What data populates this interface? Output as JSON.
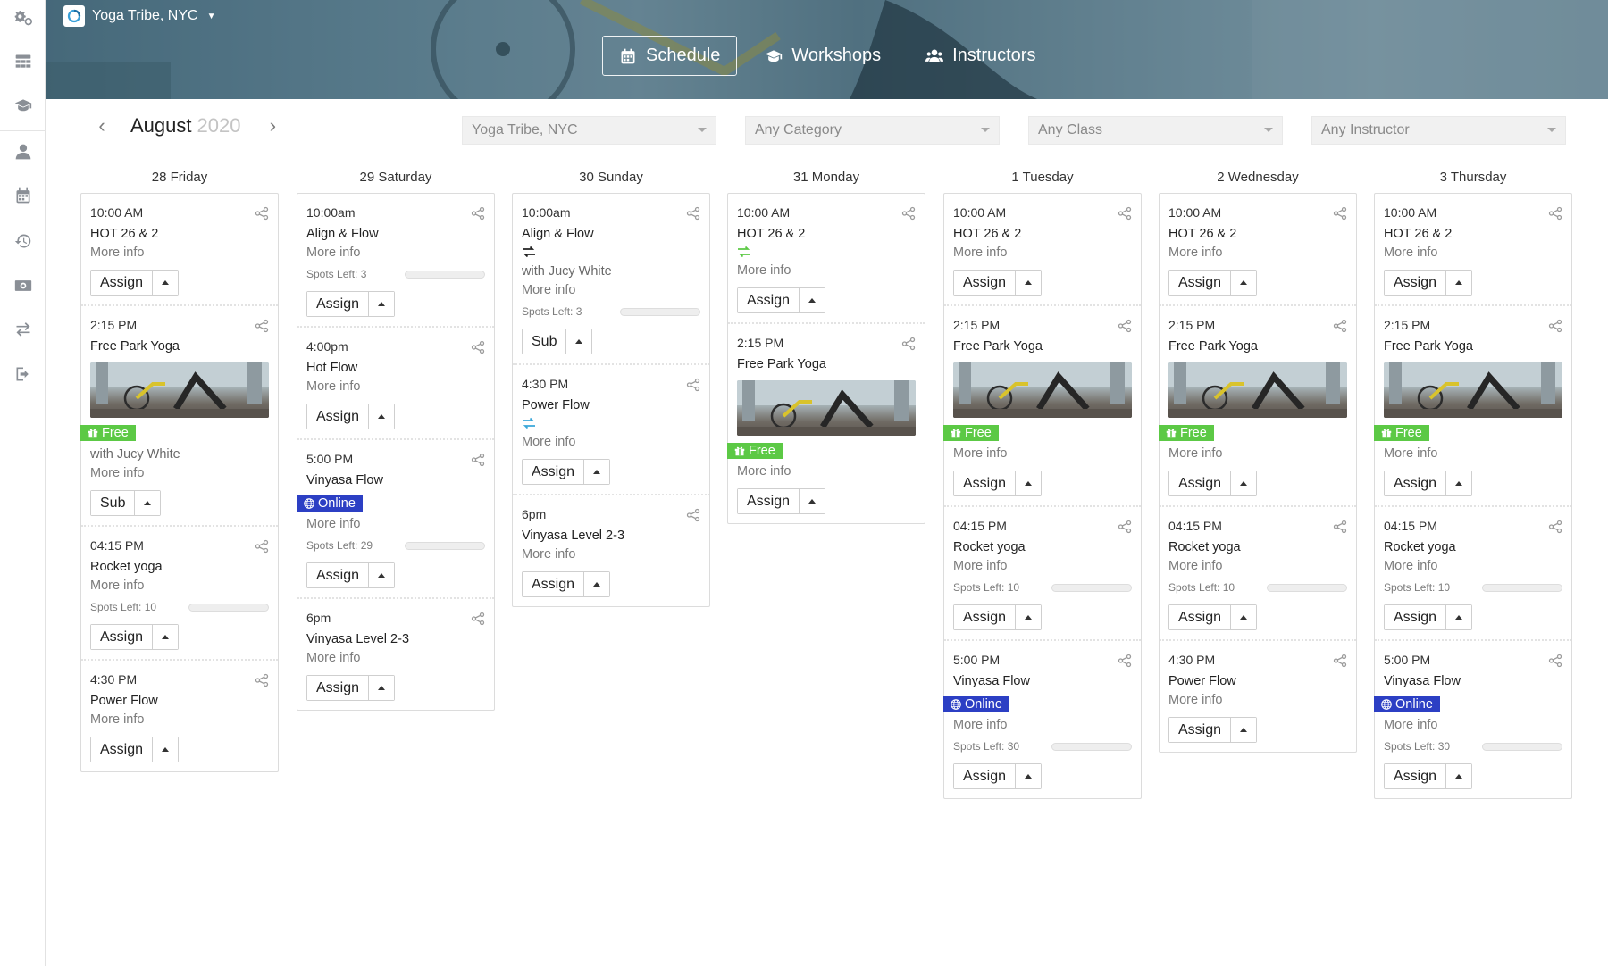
{
  "studio": {
    "name": "Yoga Tribe, NYC"
  },
  "nav": [
    {
      "label": "Schedule",
      "icon": "calendar-icon",
      "active": true
    },
    {
      "label": "Workshops",
      "icon": "graduation-cap-icon",
      "active": false
    },
    {
      "label": "Instructors",
      "icon": "users-icon",
      "active": false
    }
  ],
  "sidebar": [
    "gears-icon",
    "dashboard-icon",
    "graduation-cap-icon",
    "user-icon",
    "calendar-icon",
    "history-icon",
    "money-icon",
    "exchange-icon",
    "sign-out-icon"
  ],
  "calendar": {
    "month": "August",
    "year": "2020"
  },
  "filters": {
    "studio": "Yoga Tribe, NYC",
    "category": "Any Category",
    "class": "Any Class",
    "instructor": "Any Instructor"
  },
  "colors": {
    "free": "#5cc945",
    "online": "#2c3fc4",
    "swap_dark": "#222222",
    "swap_green": "#5cc945",
    "swap_blue": "#3ba7d9"
  },
  "days": [
    {
      "label": "28 Friday",
      "classes": [
        {
          "time": "10:00 AM",
          "name": "HOT 26 & 2",
          "more": "More info",
          "action": "Assign"
        },
        {
          "time": "2:15 PM",
          "name": "Free Park Yoga",
          "image": true,
          "badge": "Free",
          "badge_type": "free",
          "instructor": "with Jucy White",
          "more": "More info",
          "action": "Sub"
        },
        {
          "time": "04:15 PM",
          "name": "Rocket yoga",
          "more": "More info",
          "spots": "Spots Left: 10",
          "action": "Assign"
        },
        {
          "time": "4:30 PM",
          "name": "Power Flow",
          "more": "More info",
          "action": "Assign"
        }
      ]
    },
    {
      "label": "29 Saturday",
      "classes": [
        {
          "time": "10:00am",
          "name": "Align & Flow",
          "more": "More info",
          "spots": "Spots Left: 3",
          "action": "Assign"
        },
        {
          "time": "4:00pm",
          "name": "Hot Flow",
          "more": "More info",
          "action": "Assign"
        },
        {
          "time": "5:00 PM",
          "name": "Vinyasa Flow",
          "badge": "Online",
          "badge_type": "online",
          "more": "More info",
          "spots": "Spots Left: 29",
          "action": "Assign"
        },
        {
          "time": "6pm",
          "name": "Vinyasa Level 2-3",
          "more": "More info",
          "action": "Assign"
        }
      ]
    },
    {
      "label": "30 Sunday",
      "classes": [
        {
          "time": "10:00am",
          "name": "Align & Flow",
          "swap": "dark",
          "instructor": "with Jucy White",
          "more": "More info",
          "spots": "Spots Left: 3",
          "action": "Sub"
        },
        {
          "time": "4:30 PM",
          "name": "Power Flow",
          "swap": "blue",
          "more": "More info",
          "action": "Assign"
        },
        {
          "time": "6pm",
          "name": "Vinyasa Level 2-3",
          "more": "More info",
          "action": "Assign"
        }
      ]
    },
    {
      "label": "31 Monday",
      "classes": [
        {
          "time": "10:00 AM",
          "name": "HOT 26 & 2",
          "swap": "green",
          "more": "More info",
          "action": "Assign"
        },
        {
          "time": "2:15 PM",
          "name": "Free Park Yoga",
          "image": true,
          "badge": "Free",
          "badge_type": "free",
          "more": "More info",
          "action": "Assign"
        }
      ]
    },
    {
      "label": "1 Tuesday",
      "classes": [
        {
          "time": "10:00 AM",
          "name": "HOT 26 & 2",
          "more": "More info",
          "action": "Assign"
        },
        {
          "time": "2:15 PM",
          "name": "Free Park Yoga",
          "image": true,
          "badge": "Free",
          "badge_type": "free",
          "more": "More info",
          "action": "Assign"
        },
        {
          "time": "04:15 PM",
          "name": "Rocket yoga",
          "more": "More info",
          "spots": "Spots Left: 10",
          "action": "Assign"
        },
        {
          "time": "5:00 PM",
          "name": "Vinyasa Flow",
          "badge": "Online",
          "badge_type": "online",
          "more": "More info",
          "spots": "Spots Left: 30",
          "action": "Assign"
        }
      ]
    },
    {
      "label": "2 Wednesday",
      "classes": [
        {
          "time": "10:00 AM",
          "name": "HOT 26 & 2",
          "more": "More info",
          "action": "Assign"
        },
        {
          "time": "2:15 PM",
          "name": "Free Park Yoga",
          "image": true,
          "badge": "Free",
          "badge_type": "free",
          "more": "More info",
          "action": "Assign"
        },
        {
          "time": "04:15 PM",
          "name": "Rocket yoga",
          "more": "More info",
          "spots": "Spots Left: 10",
          "action": "Assign"
        },
        {
          "time": "4:30 PM",
          "name": "Power Flow",
          "more": "More info",
          "action": "Assign"
        }
      ]
    },
    {
      "label": "3 Thursday",
      "classes": [
        {
          "time": "10:00 AM",
          "name": "HOT 26 & 2",
          "more": "More info",
          "action": "Assign"
        },
        {
          "time": "2:15 PM",
          "name": "Free Park Yoga",
          "image": true,
          "badge": "Free",
          "badge_type": "free",
          "more": "More info",
          "action": "Assign"
        },
        {
          "time": "04:15 PM",
          "name": "Rocket yoga",
          "more": "More info",
          "spots": "Spots Left: 10",
          "action": "Assign"
        },
        {
          "time": "5:00 PM",
          "name": "Vinyasa Flow",
          "badge": "Online",
          "badge_type": "online",
          "more": "More info",
          "spots": "Spots Left: 30",
          "action": "Assign"
        }
      ]
    }
  ]
}
